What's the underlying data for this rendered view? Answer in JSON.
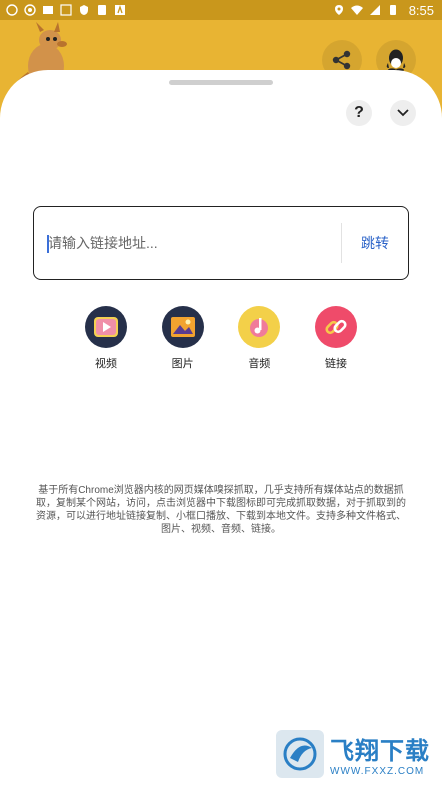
{
  "status_bar": {
    "time": "8:55",
    "left_icons": [
      "android-icon",
      "android-icon",
      "app-icon",
      "app-icon",
      "shield-icon",
      "sd-card-icon",
      "app-icon"
    ],
    "right_icons": [
      "location-icon",
      "wifi-icon",
      "signal-icon",
      "battery-icon"
    ]
  },
  "header": {
    "share_icon": "share-icon",
    "qq_icon": "qq-penguin-icon",
    "mascot": "kangaroo-logo"
  },
  "sheet": {
    "help_label": "?",
    "collapse_icon": "chevron-down-icon"
  },
  "url_input": {
    "placeholder": "请输入链接地址...",
    "value": "",
    "go_label": "跳转"
  },
  "categories": [
    {
      "label": "视频",
      "icon": "video-icon",
      "color": "#f4d052"
    },
    {
      "label": "图片",
      "icon": "image-icon",
      "color": "#f2a32f"
    },
    {
      "label": "音频",
      "icon": "audio-icon",
      "color": "#f3d049"
    },
    {
      "label": "链接",
      "icon": "link-icon",
      "color": "#ef4b6a"
    }
  ],
  "description": "基于所有Chrome浏览器内核的网页媒体嗅探抓取，几乎支持所有媒体站点的数据抓取，复制某个网站，访问，点击浏览器中下载图标即可完成抓取数据，对于抓取到的资源，可以进行地址链接复制、小框口播放、下载到本地文件。支持多种文件格式、图片、视频、音频、链接。",
  "watermark": {
    "title": "飞翔下载",
    "url": "WWW.FXXZ.COM"
  },
  "colors": {
    "status_bar": "#c9971c",
    "header": "#e8b433",
    "accent_link": "#2b63c8"
  }
}
